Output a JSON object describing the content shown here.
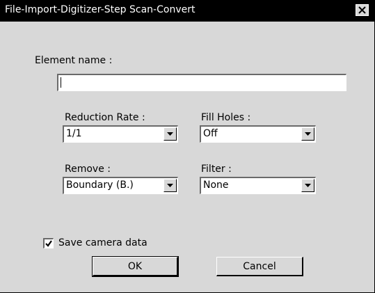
{
  "window": {
    "title": "File-Import-Digitizer-Step Scan-Convert",
    "close_icon": "close-x-icon"
  },
  "element_name": {
    "label": "Element name :",
    "value": ""
  },
  "reduction_rate": {
    "label": "Reduction Rate :",
    "value": "1/1"
  },
  "fill_holes": {
    "label": "Fill Holes :",
    "value": "Off"
  },
  "remove": {
    "label": "Remove :",
    "value": "Boundary (B.)"
  },
  "filter": {
    "label": "Filter :",
    "value": "None"
  },
  "save_camera": {
    "label": "Save camera data",
    "checked": true
  },
  "buttons": {
    "ok": "OK",
    "cancel": "Cancel"
  },
  "colors": {
    "titlebar": "#000000",
    "dialog_bg": "#d8d8d8"
  }
}
